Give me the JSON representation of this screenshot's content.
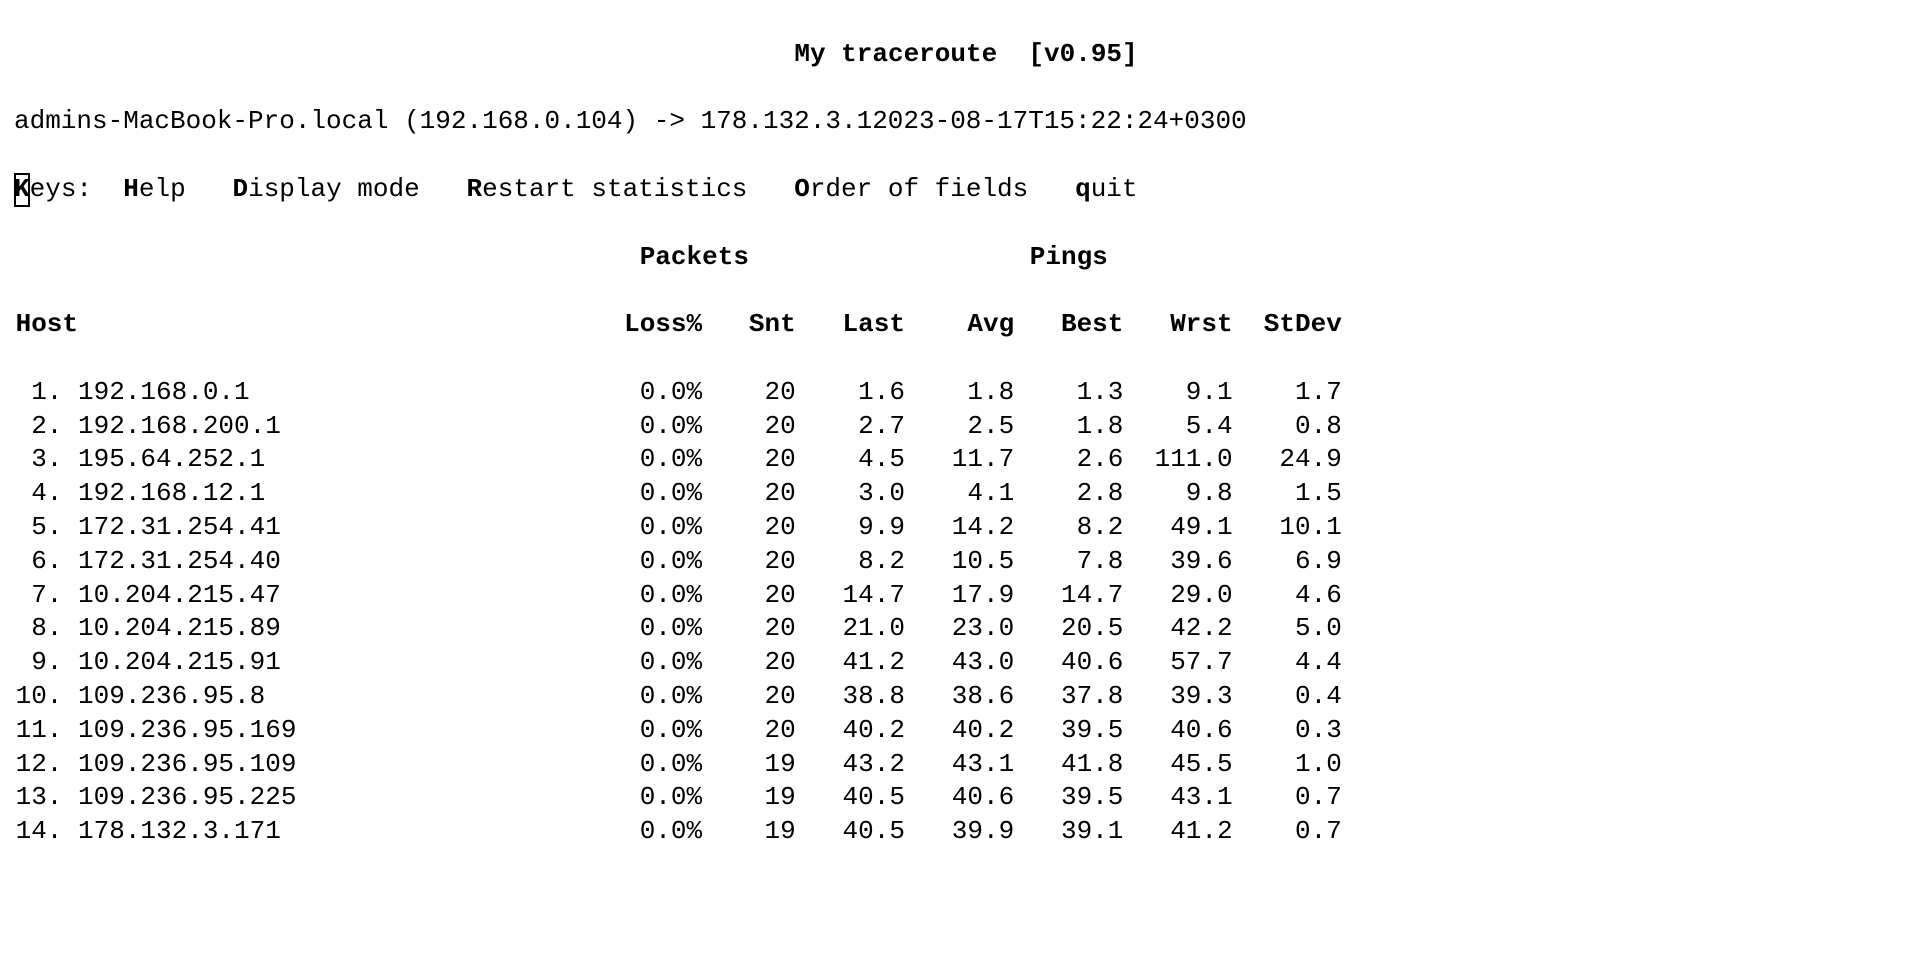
{
  "title": {
    "name": "My traceroute",
    "version_label": "[v0.95]"
  },
  "info": {
    "hostname": "admins-MacBook-Pro.local",
    "local_ip": "(192.168.0.104)",
    "arrow": "->",
    "dest_and_time": "178.132.3.12023-08-17T15:22:24+0300"
  },
  "keys": {
    "label_prefix_hot": "K",
    "label_prefix_rest": "eys:",
    "help_hot": "H",
    "help_rest": "elp",
    "display_hot": "D",
    "display_rest": "isplay mode",
    "restart_hot": "R",
    "restart_rest": "estart statistics",
    "order_hot": "O",
    "order_rest": "rder of fields",
    "quit_hot": "q",
    "quit_rest": "uit"
  },
  "sections": {
    "packets": "Packets",
    "pings": "Pings"
  },
  "columns": {
    "host": "Host",
    "loss": "Loss%",
    "snt": "Snt",
    "last": "Last",
    "avg": "Avg",
    "best": "Best",
    "wrst": "Wrst",
    "stdev": "StDev"
  },
  "hops": [
    {
      "n": 1,
      "host": "192.168.0.1",
      "loss": "0.0%",
      "snt": "20",
      "last": "1.6",
      "avg": "1.8",
      "best": "1.3",
      "wrst": "9.1",
      "stdev": "1.7"
    },
    {
      "n": 2,
      "host": "192.168.200.1",
      "loss": "0.0%",
      "snt": "20",
      "last": "2.7",
      "avg": "2.5",
      "best": "1.8",
      "wrst": "5.4",
      "stdev": "0.8"
    },
    {
      "n": 3,
      "host": "195.64.252.1",
      "loss": "0.0%",
      "snt": "20",
      "last": "4.5",
      "avg": "11.7",
      "best": "2.6",
      "wrst": "111.0",
      "stdev": "24.9"
    },
    {
      "n": 4,
      "host": "192.168.12.1",
      "loss": "0.0%",
      "snt": "20",
      "last": "3.0",
      "avg": "4.1",
      "best": "2.8",
      "wrst": "9.8",
      "stdev": "1.5"
    },
    {
      "n": 5,
      "host": "172.31.254.41",
      "loss": "0.0%",
      "snt": "20",
      "last": "9.9",
      "avg": "14.2",
      "best": "8.2",
      "wrst": "49.1",
      "stdev": "10.1"
    },
    {
      "n": 6,
      "host": "172.31.254.40",
      "loss": "0.0%",
      "snt": "20",
      "last": "8.2",
      "avg": "10.5",
      "best": "7.8",
      "wrst": "39.6",
      "stdev": "6.9"
    },
    {
      "n": 7,
      "host": "10.204.215.47",
      "loss": "0.0%",
      "snt": "20",
      "last": "14.7",
      "avg": "17.9",
      "best": "14.7",
      "wrst": "29.0",
      "stdev": "4.6"
    },
    {
      "n": 8,
      "host": "10.204.215.89",
      "loss": "0.0%",
      "snt": "20",
      "last": "21.0",
      "avg": "23.0",
      "best": "20.5",
      "wrst": "42.2",
      "stdev": "5.0"
    },
    {
      "n": 9,
      "host": "10.204.215.91",
      "loss": "0.0%",
      "snt": "20",
      "last": "41.2",
      "avg": "43.0",
      "best": "40.6",
      "wrst": "57.7",
      "stdev": "4.4"
    },
    {
      "n": 10,
      "host": "109.236.95.8",
      "loss": "0.0%",
      "snt": "20",
      "last": "38.8",
      "avg": "38.6",
      "best": "37.8",
      "wrst": "39.3",
      "stdev": "0.4"
    },
    {
      "n": 11,
      "host": "109.236.95.169",
      "loss": "0.0%",
      "snt": "20",
      "last": "40.2",
      "avg": "40.2",
      "best": "39.5",
      "wrst": "40.6",
      "stdev": "0.3"
    },
    {
      "n": 12,
      "host": "109.236.95.109",
      "loss": "0.0%",
      "snt": "19",
      "last": "43.2",
      "avg": "43.1",
      "best": "41.8",
      "wrst": "45.5",
      "stdev": "1.0"
    },
    {
      "n": 13,
      "host": "109.236.95.225",
      "loss": "0.0%",
      "snt": "19",
      "last": "40.5",
      "avg": "40.6",
      "best": "39.5",
      "wrst": "43.1",
      "stdev": "0.7"
    },
    {
      "n": 14,
      "host": "178.132.3.171",
      "loss": "0.0%",
      "snt": "19",
      "last": "40.5",
      "avg": "39.9",
      "best": "39.1",
      "wrst": "41.2",
      "stdev": "0.7"
    }
  ]
}
